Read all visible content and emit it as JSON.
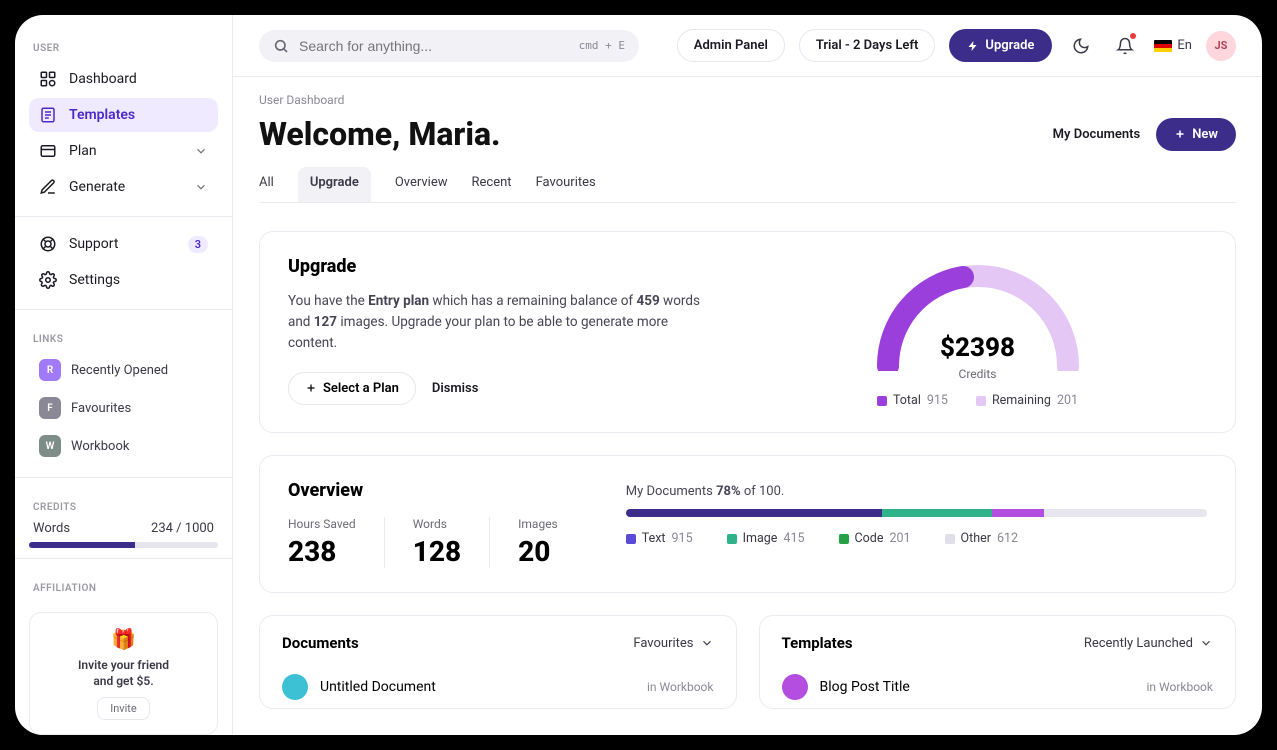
{
  "search": {
    "placeholder": "Search for anything...",
    "shortcut": "cmd + E"
  },
  "topbar": {
    "admin": "Admin Panel",
    "trial": "Trial - 2 Days Left",
    "upgrade": "Upgrade",
    "lang": "En",
    "avatar": "JS"
  },
  "sidebar": {
    "user_label": "USER",
    "items": [
      {
        "label": "Dashboard"
      },
      {
        "label": "Templates"
      },
      {
        "label": "Plan"
      },
      {
        "label": "Generate"
      },
      {
        "label": "Support",
        "badge": "3"
      },
      {
        "label": "Settings"
      }
    ],
    "links_label": "LINKS",
    "links": [
      {
        "letter": "R",
        "label": "Recently Opened",
        "color": "#a07af8"
      },
      {
        "letter": "F",
        "label": "Favourites",
        "color": "#8a8895"
      },
      {
        "letter": "W",
        "label": "Workbook",
        "color": "#7f8d89"
      }
    ],
    "credits_label": "CREDITS",
    "credits": {
      "name": "Words",
      "text": "234 / 1000",
      "pct": 56
    },
    "affil_label": "AFFILIATION",
    "affil": {
      "text1": "Invite your friend",
      "text2": "and get $5.",
      "btn": "Invite"
    }
  },
  "page": {
    "crumb": "User Dashboard",
    "welcome": "Welcome, Maria.",
    "my_docs": "My Documents",
    "new": "New",
    "tabs": [
      "All",
      "Upgrade",
      "Overview",
      "Recent",
      "Favourites"
    ]
  },
  "upgrade": {
    "title": "Upgrade",
    "plan_name": "Entry plan",
    "words": "459",
    "images": "127",
    "text_pre": "You have the ",
    "text_mid1": " which has a remaining balance of ",
    "text_mid2": " words and ",
    "text_post": " images. Upgrade your plan to be able to generate more content.",
    "select": "Select a Plan",
    "dismiss": "Dismiss",
    "credits_value": "$2398",
    "credits_label": "Credits",
    "legend": [
      {
        "label": "Total",
        "value": "915",
        "color": "#9b3fdc"
      },
      {
        "label": "Remaining",
        "value": "201",
        "color": "#e5c7f6"
      }
    ]
  },
  "overview": {
    "title": "Overview",
    "stats": [
      {
        "label": "Hours Saved",
        "value": "238"
      },
      {
        "label": "Words",
        "value": "128"
      },
      {
        "label": "Images",
        "value": "20"
      }
    ],
    "caption_pre": "My Documents ",
    "caption_pct": "78%",
    "caption_post": " of 100.",
    "legend": [
      {
        "label": "Text",
        "value": "915",
        "color": "#3d2d8a",
        "pct": 44
      },
      {
        "label": "Image",
        "value": "415",
        "color": "#2db28a",
        "pct": 19
      },
      {
        "label": "Code",
        "value": "201",
        "color": "#b34ee0",
        "pct": 9
      },
      {
        "label": "Other",
        "value": "612",
        "color": "#e0dee8",
        "pct": 28
      }
    ]
  },
  "documents": {
    "title": "Documents",
    "dropdown": "Favourites",
    "rows": [
      {
        "title": "Untitled Document",
        "loc": "in Workbook",
        "color": "#3cc0d4"
      }
    ]
  },
  "templates": {
    "title": "Templates",
    "dropdown": "Recently Launched",
    "rows": [
      {
        "title": "Blog Post Title",
        "loc": "in Workbook",
        "color": "#b34ee0"
      }
    ]
  },
  "chart_data": {
    "type": "pie",
    "title": "Credits",
    "value_label": "$2398",
    "series": [
      {
        "name": "Total",
        "value": 915
      },
      {
        "name": "Remaining",
        "value": 201
      }
    ]
  }
}
